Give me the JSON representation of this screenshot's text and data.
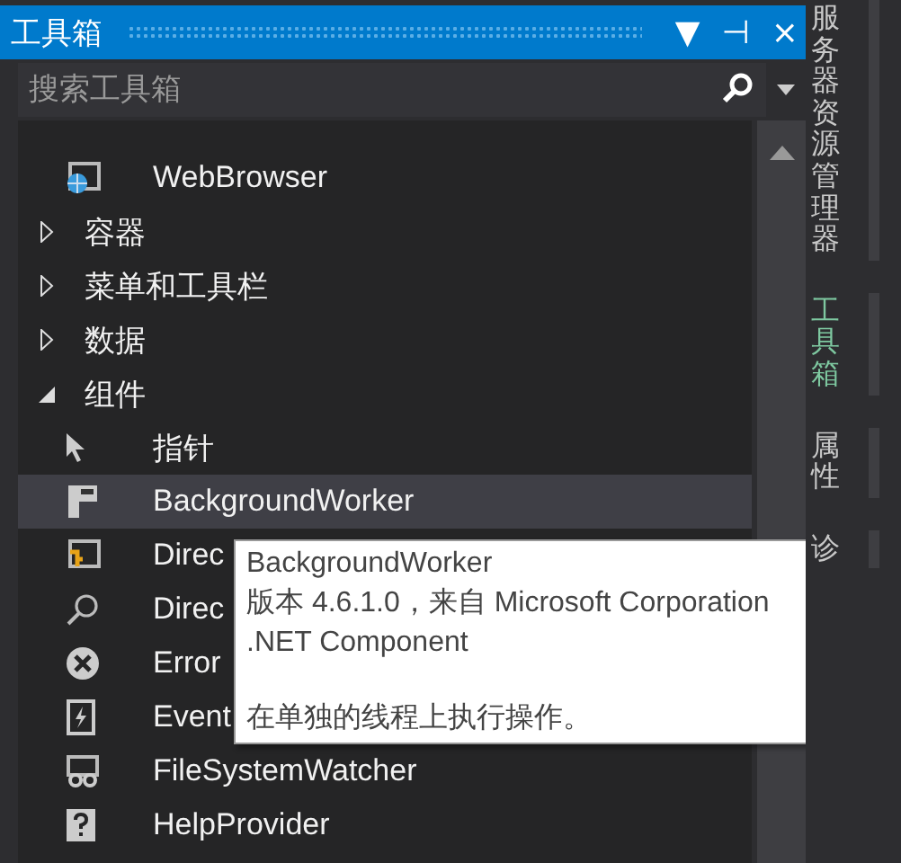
{
  "window": {
    "title": "工具箱"
  },
  "title_buttons": [
    "▼",
    "⊣",
    "×"
  ],
  "search": {
    "placeholder": "搜索工具箱"
  },
  "items": [
    {
      "kind": "tool",
      "label": "WebBrowser"
    },
    {
      "kind": "category",
      "label": "容器",
      "expanded": false
    },
    {
      "kind": "category",
      "label": "菜单和工具栏",
      "expanded": false
    },
    {
      "kind": "category",
      "label": "数据",
      "expanded": false
    },
    {
      "kind": "category",
      "label": "组件",
      "expanded": true,
      "children": [
        {
          "kind": "tool",
          "label": "指针",
          "selected": false
        },
        {
          "kind": "tool",
          "label": "BackgroundWorker",
          "selected": true
        },
        {
          "kind": "tool",
          "label": "Direc",
          "selected": false
        },
        {
          "kind": "tool",
          "label": "Direc",
          "selected": false
        },
        {
          "kind": "tool",
          "label": "Error",
          "selected": false
        },
        {
          "kind": "tool",
          "label": "Event",
          "selected": false
        },
        {
          "kind": "tool",
          "label": "FileSystemWatcher",
          "selected": false
        },
        {
          "kind": "tool",
          "label": "HelpProvider",
          "selected": false
        }
      ]
    }
  ],
  "tooltip": {
    "title": "BackgroundWorker",
    "details": [
      "版本 4.6.1.0，来自 Microsoft Corporation",
      ".NET Component"
    ],
    "description": "在单独的线程上执行操作。"
  },
  "side_tabs": [
    {
      "label": "服务器资源管理器",
      "selected": false
    },
    {
      "label": "工具箱",
      "selected": true
    },
    {
      "label": "属性",
      "selected": false
    },
    {
      "label": "诊",
      "selected": false
    }
  ]
}
